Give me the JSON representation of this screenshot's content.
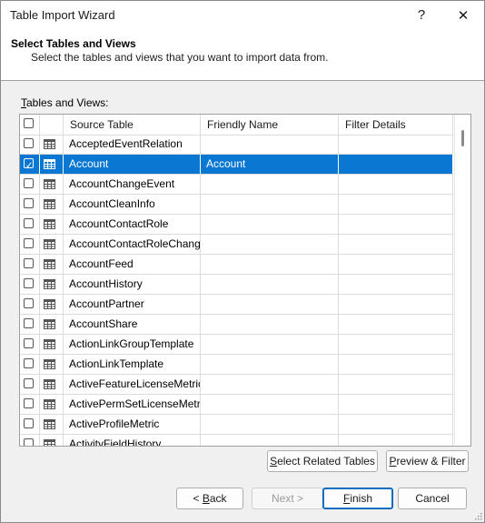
{
  "window": {
    "title": "Table Import Wizard",
    "help_glyph": "?",
    "close_glyph": "✕"
  },
  "header": {
    "title": "Select Tables and Views",
    "description": "Select the tables and views that you want to import data from."
  },
  "section_label_accel": "T",
  "section_label_rest": "ables and Views:",
  "grid": {
    "columns": [
      "Source Table",
      "Friendly Name",
      "Filter Details"
    ],
    "rows": [
      {
        "source": "AcceptedEventRelation",
        "friendly": "",
        "filter": "",
        "checked": false
      },
      {
        "source": "Account",
        "friendly": "Account",
        "filter": "",
        "checked": true
      },
      {
        "source": "AccountChangeEvent",
        "friendly": "",
        "filter": "",
        "checked": false
      },
      {
        "source": "AccountCleanInfo",
        "friendly": "",
        "filter": "",
        "checked": false
      },
      {
        "source": "AccountContactRole",
        "friendly": "",
        "filter": "",
        "checked": false
      },
      {
        "source": "AccountContactRoleChang...",
        "friendly": "",
        "filter": "",
        "checked": false
      },
      {
        "source": "AccountFeed",
        "friendly": "",
        "filter": "",
        "checked": false
      },
      {
        "source": "AccountHistory",
        "friendly": "",
        "filter": "",
        "checked": false
      },
      {
        "source": "AccountPartner",
        "friendly": "",
        "filter": "",
        "checked": false
      },
      {
        "source": "AccountShare",
        "friendly": "",
        "filter": "",
        "checked": false
      },
      {
        "source": "ActionLinkGroupTemplate",
        "friendly": "",
        "filter": "",
        "checked": false
      },
      {
        "source": "ActionLinkTemplate",
        "friendly": "",
        "filter": "",
        "checked": false
      },
      {
        "source": "ActiveFeatureLicenseMetric",
        "friendly": "",
        "filter": "",
        "checked": false
      },
      {
        "source": "ActivePermSetLicenseMetric",
        "friendly": "",
        "filter": "",
        "checked": false
      },
      {
        "source": "ActiveProfileMetric",
        "friendly": "",
        "filter": "",
        "checked": false
      },
      {
        "source": "ActivityFieldHistory",
        "friendly": "",
        "filter": "",
        "checked": false
      }
    ]
  },
  "buttons": {
    "select_related": "Select Related Tables",
    "preview_filter": "Preview & Filter",
    "back": "< Back",
    "next": "Next >",
    "finish": "Finish",
    "cancel": "Cancel"
  },
  "colors": {
    "selection": "#0a77d2"
  }
}
